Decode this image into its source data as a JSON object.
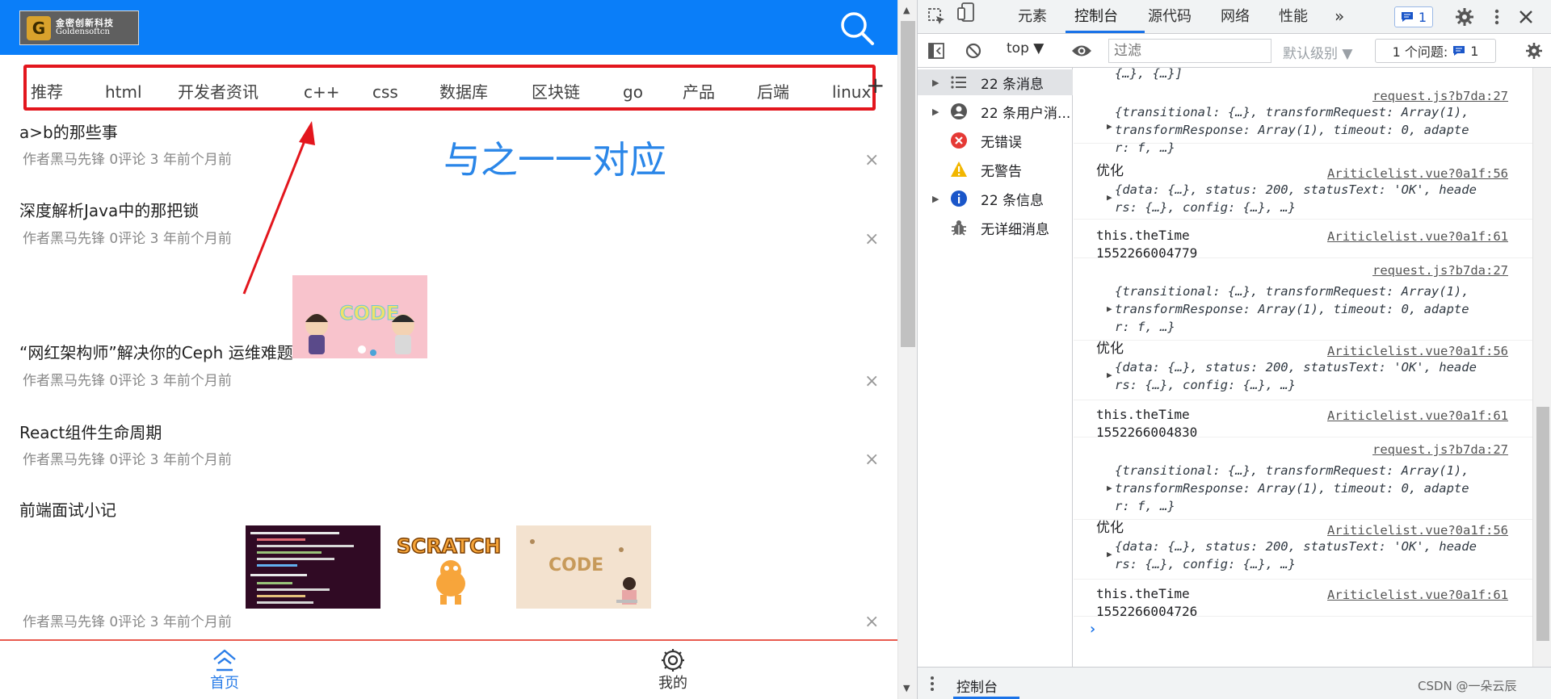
{
  "app": {
    "logo": {
      "mark": "G",
      "cn_name": "金密创新科技",
      "en_name": "Goldensoftcn"
    },
    "categories": [
      "推荐",
      "html",
      "开发者资讯",
      "c++",
      "css",
      "数据库",
      "区块链",
      "go",
      "产品",
      "后端",
      "linux"
    ],
    "add_category": "+",
    "annotation": "与之一一对应",
    "articles": [
      {
        "title": "a>b的那些事",
        "meta": "作者黑马先锋  0评论  3 年前个月前"
      },
      {
        "title": "深度解析Java中的那把锁",
        "meta": "作者黑马先锋  0评论  3 年前个月前"
      },
      {
        "title": "“网红架构师”解决你的Ceph 运维难题",
        "meta": "作者黑马先锋  0评论  3 年前个月前"
      },
      {
        "title": "React组件生命周期",
        "meta": "作者黑马先锋  0评论  3 年前个月前"
      },
      {
        "title": "前端面试小记",
        "meta": "作者黑马先锋  0评论  3 年前个月前"
      }
    ],
    "close_glyph": "×",
    "thumb_text": {
      "code": "CODE",
      "scratch": "SCRATCH"
    },
    "tabbar": [
      {
        "label": "首页",
        "icon": "home-icon",
        "active": true
      },
      {
        "label": "我的",
        "icon": "gear-icon",
        "active": false
      }
    ],
    "colors": {
      "header": "#0a7ef9",
      "highlight_box": "#e3161d",
      "annotation": "#2a86e8",
      "tab_active": "#2a7de8"
    }
  },
  "devtools": {
    "tabs": [
      "元素",
      "控制台",
      "源代码",
      "网络",
      "性能"
    ],
    "active_tab": "控制台",
    "more_tabs": "»",
    "message_badge": "1",
    "toolbar": {
      "context": "top ▼",
      "filter_placeholder": "过滤",
      "level": "默认级别 ▼",
      "issues_label": "1 个问题:",
      "issues_count": "1"
    },
    "sidebar": [
      {
        "label": "22 条消息",
        "icon": "list-icon",
        "selected": true,
        "expandable": true
      },
      {
        "label": "22 条用户消...",
        "icon": "user-icon",
        "selected": false,
        "expandable": true
      },
      {
        "label": "无错误",
        "icon": "error-icon",
        "selected": false,
        "expandable": false
      },
      {
        "label": "无警告",
        "icon": "warning-icon",
        "selected": false,
        "expandable": false
      },
      {
        "label": "22 条信息",
        "icon": "info-icon",
        "selected": false,
        "expandable": true
      },
      {
        "label": "无详细消息",
        "icon": "bug-icon",
        "selected": false,
        "expandable": false
      }
    ],
    "console": {
      "top_fragment": "{…}, {…}]",
      "request_source": "request.js?b7da:27",
      "list_source_56": "Ariticlelist.vue?0a1f:56",
      "list_source_61": "Ariticlelist.vue?0a1f:61",
      "request_line1": "{transitional: {…}, transformRequest: Array(1),",
      "request_line2": "transformResponse: Array(1), timeout: 0, adapte",
      "request_line3": "r: f, …}",
      "youhua": "优化",
      "response_line1": "{data: {…}, status: 200, statusText: 'OK', heade",
      "response_line2": "rs: {…}, config: {…}, …}",
      "thetime_label": "this.theTime",
      "times": [
        "1552266004779",
        "1552266004830",
        "1552266004726"
      ],
      "prompt": "›"
    },
    "drawer_tab": "控制台",
    "watermark": "CSDN @一朵云辰"
  }
}
